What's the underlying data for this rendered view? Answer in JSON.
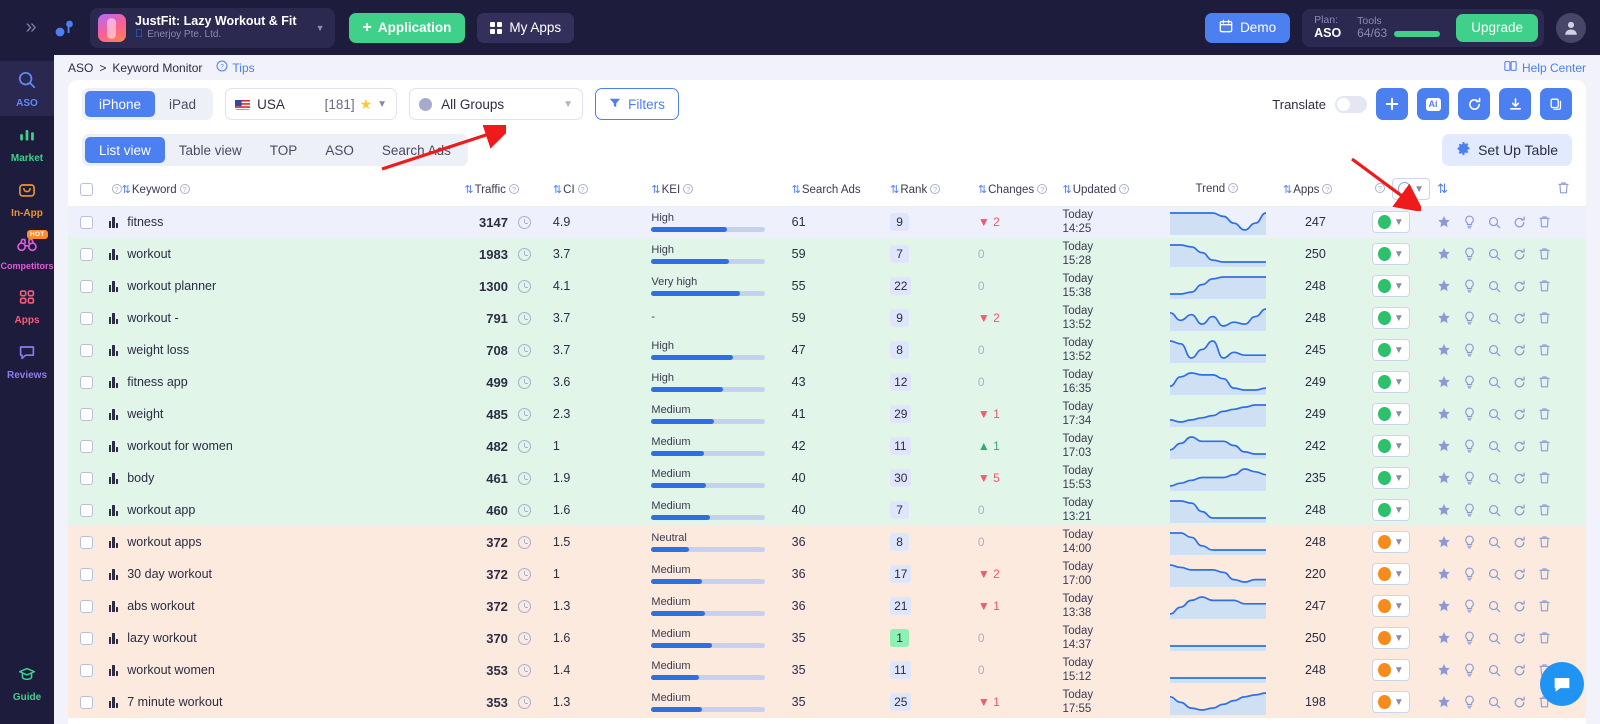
{
  "topbar": {
    "collapse_icon": "chevron-double-right-icon",
    "app": {
      "name": "JustFit: Lazy Workout & Fit",
      "developer": "Enerjoy Pte. Ltd.",
      "platform_icon": "apple-icon"
    },
    "application_button": "Application",
    "my_apps_button": "My Apps",
    "demo_button": "Demo",
    "plan_label": "Plan:",
    "plan_value": "ASO",
    "tools_label": "Tools",
    "tools_value": "64/63",
    "upgrade_button": "Upgrade",
    "accent_green": "#3fd08a",
    "accent_blue": "#4c7ff0"
  },
  "sidebar": {
    "items": [
      {
        "label": "ASO",
        "icon": "search-icon",
        "color": "#5f8bf5",
        "active": true,
        "badge": ""
      },
      {
        "label": "Market",
        "icon": "bar-chart-icon",
        "color": "#3fd08a",
        "active": false,
        "badge": ""
      },
      {
        "label": "In-App",
        "icon": "shopping-bag-icon",
        "color": "#f0932b",
        "active": false,
        "badge": ""
      },
      {
        "label": "Competitors",
        "icon": "binoculars-icon",
        "color": "#e05bd9",
        "active": false,
        "badge": "HOT"
      },
      {
        "label": "Apps",
        "icon": "grid-icon",
        "color": "#f2607a",
        "active": false,
        "badge": ""
      },
      {
        "label": "Reviews",
        "icon": "chat-icon",
        "color": "#8f7bf0",
        "active": false,
        "badge": ""
      }
    ],
    "bottom": {
      "label": "Guide",
      "icon": "graduation-cap-icon",
      "color": "#3fd08a"
    }
  },
  "breadcrumb": {
    "root": "ASO",
    "separator": ">",
    "current": "Keyword Monitor",
    "tips": "Tips",
    "help_center": "Help Center"
  },
  "toolbar": {
    "device_tabs": [
      {
        "label": "iPhone",
        "active": true
      },
      {
        "label": "iPad",
        "active": false
      }
    ],
    "country": "USA",
    "country_count": "[181]",
    "group_select": "All Groups",
    "filters_button": "Filters",
    "translate_label": "Translate",
    "translate_on": false,
    "action_buttons": [
      {
        "name": "add-keyword-button",
        "glyph": "+"
      },
      {
        "name": "ai-button",
        "glyph": "Ai"
      },
      {
        "name": "refresh-button",
        "glyph": "refresh"
      },
      {
        "name": "download-button",
        "glyph": "download"
      },
      {
        "name": "copy-button",
        "glyph": "copy"
      }
    ]
  },
  "view_tabs": [
    {
      "label": "List view",
      "active": true
    },
    {
      "label": "Table view",
      "active": false
    },
    {
      "label": "TOP",
      "active": false
    },
    {
      "label": "ASO",
      "active": false
    },
    {
      "label": "Search Ads",
      "active": false
    }
  ],
  "setup_table_button": "Set Up Table",
  "table": {
    "columns": [
      {
        "key": "checkbox",
        "label": "",
        "sortable": false,
        "info": false
      },
      {
        "key": "keyword",
        "label": "Keyword",
        "sortable": true,
        "info": true
      },
      {
        "key": "traffic",
        "label": "Traffic",
        "sortable": true,
        "info": true
      },
      {
        "key": "ci",
        "label": "CI",
        "sortable": true,
        "info": true
      },
      {
        "key": "kei",
        "label": "KEI",
        "sortable": true,
        "info": true
      },
      {
        "key": "search_ads",
        "label": "Search Ads",
        "sortable": true,
        "info": false
      },
      {
        "key": "rank",
        "label": "Rank",
        "sortable": true,
        "info": true
      },
      {
        "key": "changes",
        "label": "Changes",
        "sortable": true,
        "info": true
      },
      {
        "key": "updated",
        "label": "Updated",
        "sortable": true,
        "info": true
      },
      {
        "key": "trend",
        "label": "Trend",
        "sortable": false,
        "info": true
      },
      {
        "key": "apps",
        "label": "Apps",
        "sortable": true,
        "info": true
      },
      {
        "key": "status",
        "label": "",
        "sortable": false,
        "info": true
      },
      {
        "key": "actions",
        "label": "",
        "sortable": true,
        "info": false
      }
    ],
    "row_actions": [
      "star-icon",
      "bulb-icon",
      "magnifier-icon",
      "refresh-icon",
      "trash-icon"
    ],
    "rows": [
      {
        "keyword": "fitness",
        "traffic": "3147",
        "ci": "4.9",
        "kei": "High",
        "kei_pct": 66,
        "search_ads": "61",
        "rank": "9",
        "rank_hl": false,
        "change": "2",
        "change_dir": "down",
        "updated_day": "Today",
        "updated_time": "14:25",
        "apps": "247",
        "status": "green",
        "row_bg": "selected",
        "trend": [
          12,
          12,
          12,
          12,
          12,
          11,
          9,
          7,
          9,
          12
        ]
      },
      {
        "keyword": "workout",
        "traffic": "1983",
        "ci": "3.7",
        "kei": "High",
        "kei_pct": 68,
        "search_ads": "59",
        "rank": "7",
        "rank_hl": false,
        "change": "0",
        "change_dir": "zero",
        "updated_day": "Today",
        "updated_time": "15:28",
        "apps": "250",
        "status": "green",
        "row_bg": "green",
        "trend": [
          16,
          16,
          15,
          12,
          8,
          7,
          7,
          7,
          7,
          7
        ]
      },
      {
        "keyword": "workout planner",
        "traffic": "1300",
        "ci": "4.1",
        "kei": "Very high",
        "kei_pct": 78,
        "search_ads": "55",
        "rank": "22",
        "rank_hl": false,
        "change": "0",
        "change_dir": "zero",
        "updated_day": "Today",
        "updated_time": "15:38",
        "apps": "248",
        "status": "green",
        "row_bg": "green",
        "trend": [
          7,
          7,
          8,
          12,
          15,
          16,
          16,
          16,
          16,
          16
        ]
      },
      {
        "keyword": "workout -",
        "traffic": "791",
        "ci": "3.7",
        "kei": "-",
        "kei_pct": -1,
        "search_ads": "59",
        "rank": "9",
        "rank_hl": false,
        "change": "2",
        "change_dir": "down",
        "updated_day": "Today",
        "updated_time": "13:52",
        "apps": "248",
        "status": "green",
        "row_bg": "green",
        "trend": [
          14,
          10,
          13,
          8,
          12,
          7,
          9,
          8,
          12,
          16
        ]
      },
      {
        "keyword": "weight loss",
        "traffic": "708",
        "ci": "3.7",
        "kei": "High",
        "kei_pct": 72,
        "search_ads": "47",
        "rank": "8",
        "rank_hl": false,
        "change": "0",
        "change_dir": "zero",
        "updated_day": "Today",
        "updated_time": "13:52",
        "apps": "245",
        "status": "green",
        "row_bg": "green",
        "trend": [
          15,
          14,
          9,
          12,
          15,
          9,
          11,
          10,
          10,
          10
        ]
      },
      {
        "keyword": "fitness app",
        "traffic": "499",
        "ci": "3.6",
        "kei": "High",
        "kei_pct": 63,
        "search_ads": "43",
        "rank": "12",
        "rank_hl": false,
        "change": "0",
        "change_dir": "zero",
        "updated_day": "Today",
        "updated_time": "16:35",
        "apps": "249",
        "status": "green",
        "row_bg": "green",
        "trend": [
          9,
          14,
          16,
          15,
          15,
          13,
          8,
          7,
          7,
          8
        ]
      },
      {
        "keyword": "weight",
        "traffic": "485",
        "ci": "2.3",
        "kei": "Medium",
        "kei_pct": 55,
        "search_ads": "41",
        "rank": "29",
        "rank_hl": false,
        "change": "1",
        "change_dir": "down",
        "updated_day": "Today",
        "updated_time": "17:34",
        "apps": "249",
        "status": "green",
        "row_bg": "green",
        "trend": [
          9,
          8,
          9,
          10,
          11,
          13,
          14,
          15,
          16,
          16
        ]
      },
      {
        "keyword": "workout for women",
        "traffic": "482",
        "ci": "1",
        "kei": "Medium",
        "kei_pct": 46,
        "search_ads": "42",
        "rank": "11",
        "rank_hl": false,
        "change": "1",
        "change_dir": "up",
        "updated_day": "Today",
        "updated_time": "17:03",
        "apps": "242",
        "status": "green",
        "row_bg": "green",
        "trend": [
          10,
          13,
          16,
          14,
          14,
          14,
          12,
          9,
          8,
          8
        ]
      },
      {
        "keyword": "body",
        "traffic": "461",
        "ci": "1.9",
        "kei": "Medium",
        "kei_pct": 48,
        "search_ads": "40",
        "rank": "30",
        "rank_hl": false,
        "change": "5",
        "change_dir": "down",
        "updated_day": "Today",
        "updated_time": "15:53",
        "apps": "235",
        "status": "green",
        "row_bg": "green",
        "trend": [
          9,
          10,
          11,
          12,
          12,
          12,
          13,
          15,
          14,
          13
        ]
      },
      {
        "keyword": "workout app",
        "traffic": "460",
        "ci": "1.6",
        "kei": "Medium",
        "kei_pct": 51,
        "search_ads": "40",
        "rank": "7",
        "rank_hl": false,
        "change": "0",
        "change_dir": "zero",
        "updated_day": "Today",
        "updated_time": "13:21",
        "apps": "248",
        "status": "green",
        "row_bg": "green",
        "trend": [
          15,
          15,
          14,
          10,
          7,
          7,
          7,
          7,
          7,
          7
        ]
      },
      {
        "keyword": "workout apps",
        "traffic": "372",
        "ci": "1.5",
        "kei": "Neutral",
        "kei_pct": 33,
        "search_ads": "36",
        "rank": "8",
        "rank_hl": false,
        "change": "0",
        "change_dir": "zero",
        "updated_day": "Today",
        "updated_time": "14:00",
        "apps": "248",
        "status": "orange",
        "row_bg": "orange",
        "trend": [
          15,
          15,
          13,
          9,
          7,
          7,
          7,
          7,
          7,
          7
        ]
      },
      {
        "keyword": "30 day workout",
        "traffic": "372",
        "ci": "1",
        "kei": "Medium",
        "kei_pct": 44,
        "search_ads": "36",
        "rank": "17",
        "rank_hl": false,
        "change": "2",
        "change_dir": "down",
        "updated_day": "Today",
        "updated_time": "17:00",
        "apps": "220",
        "status": "orange",
        "row_bg": "orange",
        "trend": [
          13,
          12,
          11,
          11,
          11,
          10,
          7,
          6,
          7,
          7
        ]
      },
      {
        "keyword": "abs workout",
        "traffic": "372",
        "ci": "1.3",
        "kei": "Medium",
        "kei_pct": 47,
        "search_ads": "36",
        "rank": "21",
        "rank_hl": false,
        "change": "1",
        "change_dir": "down",
        "updated_day": "Today",
        "updated_time": "13:38",
        "apps": "247",
        "status": "orange",
        "row_bg": "orange",
        "trend": [
          9,
          11,
          13,
          14,
          13,
          13,
          13,
          12,
          12,
          12
        ]
      },
      {
        "keyword": "lazy workout",
        "traffic": "370",
        "ci": "1.6",
        "kei": "Medium",
        "kei_pct": 53,
        "search_ads": "35",
        "rank": "1",
        "rank_hl": true,
        "change": "0",
        "change_dir": "zero",
        "updated_day": "Today",
        "updated_time": "14:37",
        "apps": "250",
        "status": "orange",
        "row_bg": "orange",
        "trend": [
          11,
          11,
          11,
          11,
          11,
          11,
          11,
          11,
          11,
          11
        ]
      },
      {
        "keyword": "workout women",
        "traffic": "353",
        "ci": "1.4",
        "kei": "Medium",
        "kei_pct": 42,
        "search_ads": "35",
        "rank": "11",
        "rank_hl": false,
        "change": "0",
        "change_dir": "zero",
        "updated_day": "Today",
        "updated_time": "15:12",
        "apps": "248",
        "status": "orange",
        "row_bg": "orange",
        "trend": [
          12,
          12,
          12,
          12,
          12,
          12,
          12,
          12,
          12,
          12
        ]
      },
      {
        "keyword": "7 minute workout",
        "traffic": "353",
        "ci": "1.3",
        "kei": "Medium",
        "kei_pct": 44,
        "search_ads": "35",
        "rank": "25",
        "rank_hl": false,
        "change": "1",
        "change_dir": "down",
        "updated_day": "Today",
        "updated_time": "17:55",
        "apps": "198",
        "status": "orange",
        "row_bg": "orange",
        "trend": [
          14,
          11,
          8,
          7,
          8,
          10,
          12,
          14,
          15,
          16
        ]
      }
    ]
  },
  "annotations": {
    "arrow1": "red-arrow-pointing-to-keyword-count",
    "arrow2": "red-arrow-pointing-to-set-up-table"
  },
  "chat_widget": {
    "icon": "chat-support-icon",
    "color": "#2094f3"
  }
}
